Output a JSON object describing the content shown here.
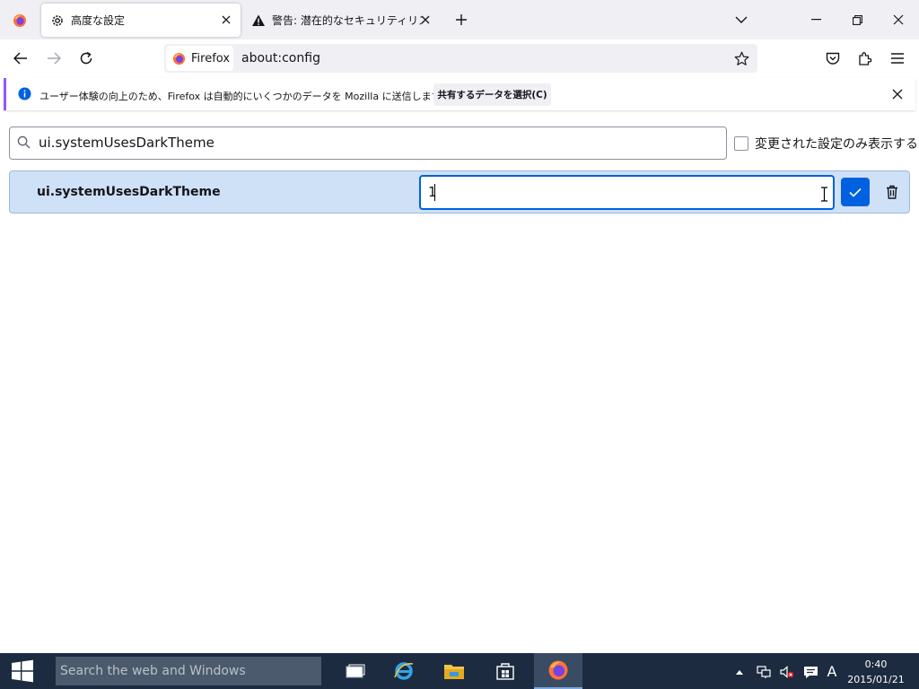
{
  "tabs": [
    {
      "icon": "firefox-icon",
      "label": ""
    },
    {
      "icon": "gear-icon",
      "label": "高度な設定",
      "active": true
    },
    {
      "icon": "warning-icon",
      "label": "警告: 潜在的なセキュリティリスクあ"
    }
  ],
  "urlbar": {
    "identity_label": "Firefox",
    "url": "about:config"
  },
  "notification": {
    "message": "ユーザー体験の向上のため、Firefox は自動的にいくつかのデータを Mozilla に送信します。",
    "button_label": "共有するデータを選択(C)"
  },
  "config": {
    "search_value": "ui.systemUsesDarkTheme",
    "only_changed_label": "変更された設定のみ表示する",
    "only_changed_checked": false,
    "pref": {
      "name": "ui.systemUsesDarkTheme",
      "edit_value": "1"
    }
  },
  "taskbar": {
    "search_placeholder": "Search the web and Windows",
    "ime_indicator": "A",
    "time": "0:40",
    "date": "2015/01/21"
  },
  "colors": {
    "accent": "#0061e0",
    "row_highlight": "#cfe1f7",
    "taskbar": "#1c2b3f"
  }
}
